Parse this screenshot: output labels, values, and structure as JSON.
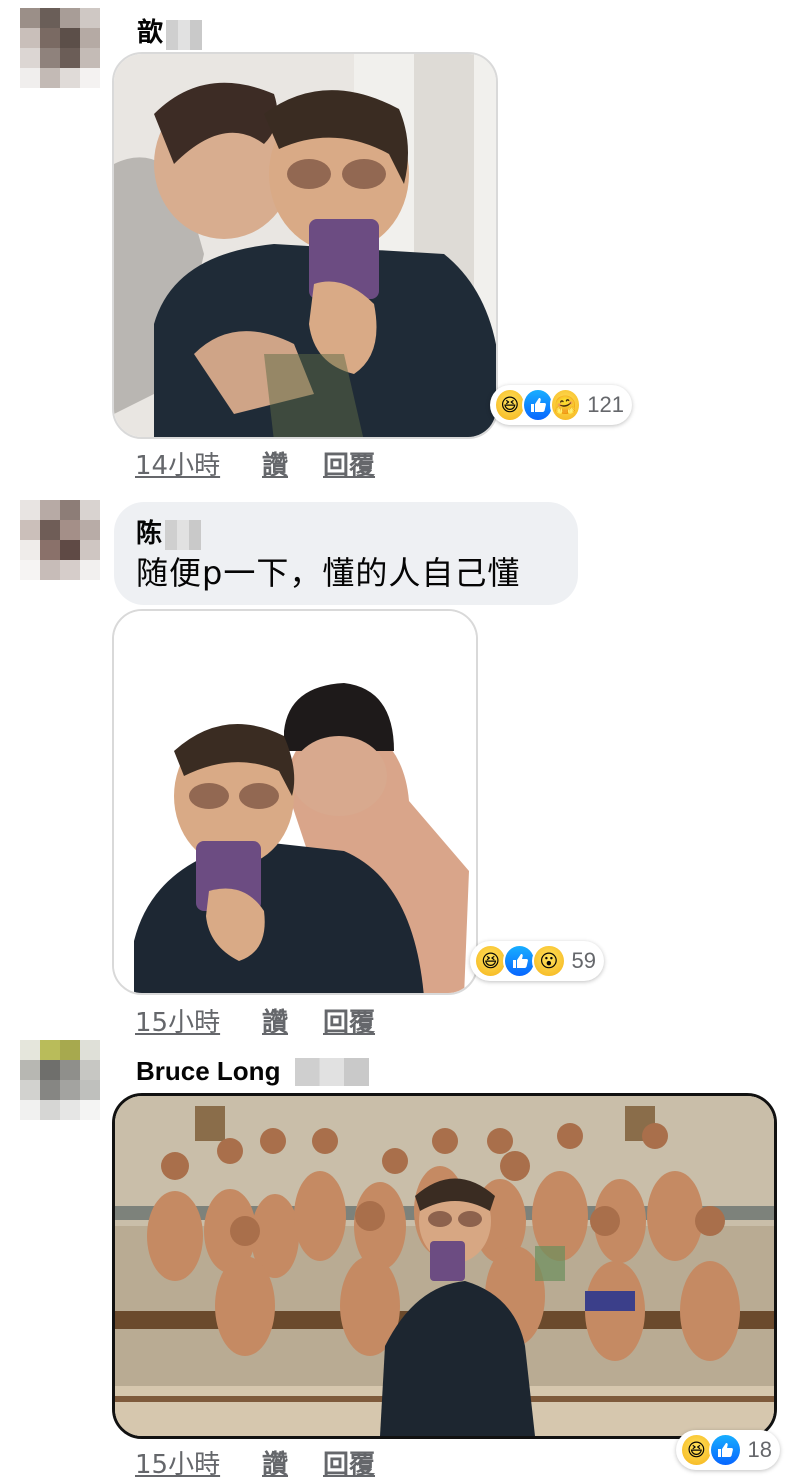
{
  "comments": [
    {
      "author": "歆",
      "text": "",
      "time": "14小時",
      "like_label": "讚",
      "reply_label": "回覆",
      "reaction_count": "121",
      "reactions": [
        "haha-icon",
        "like-icon",
        "care-icon"
      ]
    },
    {
      "author": "陈",
      "text": "随便p一下，懂的人自己懂",
      "time": "15小時",
      "like_label": "讚",
      "reply_label": "回覆",
      "reaction_count": "59",
      "reactions": [
        "haha-icon",
        "like-icon",
        "wow-icon"
      ]
    },
    {
      "author": "Bruce Long",
      "text": "",
      "time": "15小時",
      "like_label": "讚",
      "reply_label": "回覆",
      "reaction_count": "18",
      "reactions": [
        "haha-icon",
        "like-icon"
      ]
    }
  ],
  "colors": {
    "meta_text": "#65676b",
    "bubble_bg": "#eef0f3",
    "like_blue": "#0866ff",
    "emoji_yellow": "#f7c21e"
  }
}
